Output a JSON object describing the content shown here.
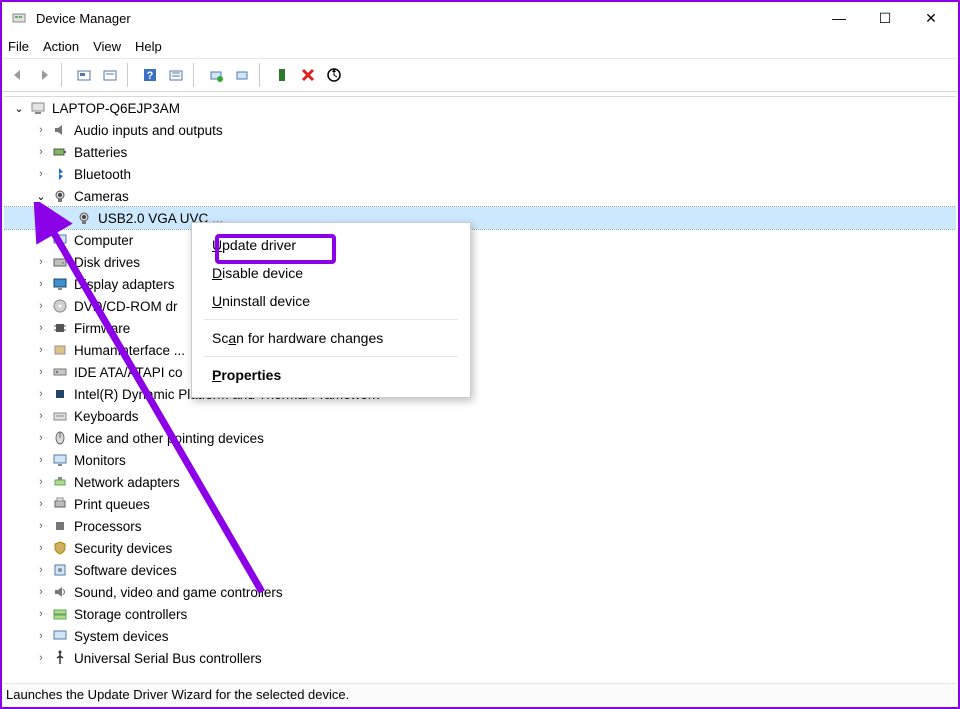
{
  "window": {
    "title": "Device Manager",
    "controls": {
      "min": "—",
      "max": "☐",
      "close": "✕"
    }
  },
  "menubar": [
    "File",
    "Action",
    "View",
    "Help"
  ],
  "toolbar_icons": [
    "nav-back-icon",
    "nav-forward-icon",
    "_sep",
    "show-hidden-icon",
    "refresh-icon",
    "_sep",
    "help-icon",
    "properties-icon",
    "_sep",
    "update-driver-icon",
    "install-old-driver-icon",
    "_sep",
    "enable-icon",
    "disable-red-icon",
    "scan-icon"
  ],
  "tree": {
    "root": {
      "label": "LAPTOP-Q6EJP3AM"
    },
    "items": [
      {
        "label": "Audio inputs and outputs",
        "icon": "audio"
      },
      {
        "label": "Batteries",
        "icon": "battery"
      },
      {
        "label": "Bluetooth",
        "icon": "bluetooth"
      },
      {
        "label": "Cameras",
        "icon": "camera",
        "expanded": true,
        "children": [
          {
            "label": "USB2.0 VGA UVC ...",
            "icon": "camera",
            "selected": true
          }
        ]
      },
      {
        "label": "Computer",
        "icon": "computer"
      },
      {
        "label": "Disk drives",
        "icon": "disk"
      },
      {
        "label": "Display adapters",
        "icon": "display"
      },
      {
        "label": "DVD/CD-ROM drives",
        "icon": "dvd",
        "truncated": "DVD/CD-ROM dr"
      },
      {
        "label": "Firmware",
        "icon": "chip",
        "truncated": "Firmware"
      },
      {
        "label": "Human Interface Devices",
        "icon": "hid",
        "truncated": "HumanInterface ..."
      },
      {
        "label": "IDE ATA/ATAPI controllers",
        "icon": "ide",
        "truncated": "IDE ATA/ATAPI co"
      },
      {
        "label": "Intel(R) Dynamic Platform and Thermal Framework",
        "icon": "intel"
      },
      {
        "label": "Keyboards",
        "icon": "keyboard"
      },
      {
        "label": "Mice and other pointing devices",
        "icon": "mouse"
      },
      {
        "label": "Monitors",
        "icon": "monitor"
      },
      {
        "label": "Network adapters",
        "icon": "network"
      },
      {
        "label": "Print queues",
        "icon": "printer"
      },
      {
        "label": "Processors",
        "icon": "cpu"
      },
      {
        "label": "Security devices",
        "icon": "security"
      },
      {
        "label": "Software devices",
        "icon": "software"
      },
      {
        "label": "Sound, video and game controllers",
        "icon": "sound"
      },
      {
        "label": "Storage controllers",
        "icon": "storage"
      },
      {
        "label": "System devices",
        "icon": "system"
      },
      {
        "label": "Universal Serial Bus controllers",
        "icon": "usb"
      }
    ]
  },
  "context_menu": {
    "items": [
      {
        "label": "Update driver",
        "underline": "U",
        "highlighted": true
      },
      {
        "label": "Disable device",
        "underline": "D"
      },
      {
        "label": "Uninstall device",
        "underline": "U"
      },
      {
        "sep": true
      },
      {
        "label": "Scan for hardware changes",
        "underline": "a"
      },
      {
        "sep": true
      },
      {
        "label": "Properties",
        "underline": "P",
        "bold": true
      }
    ]
  },
  "status": "Launches the Update Driver Wizard for the selected device.",
  "annotation": {
    "color": "#8B00E6"
  }
}
